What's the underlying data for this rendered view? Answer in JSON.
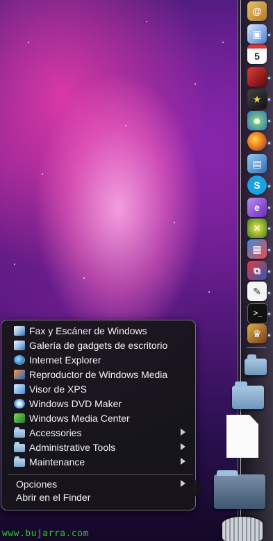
{
  "stack_menu": {
    "items": [
      {
        "label": "Fax y Escáner de Windows",
        "icon": "fax-scan-icon"
      },
      {
        "label": "Galería de gadgets de escritorio",
        "icon": "gadgets-icon"
      },
      {
        "label": "Internet Explorer",
        "icon": "internet-explorer-icon"
      },
      {
        "label": "Reproductor de Windows Media",
        "icon": "media-player-icon"
      },
      {
        "label": "Visor de XPS",
        "icon": "xps-viewer-icon"
      },
      {
        "label": "Windows DVD Maker",
        "icon": "dvd-maker-icon"
      },
      {
        "label": "Windows Media Center",
        "icon": "media-center-icon"
      },
      {
        "label": "Accessories",
        "icon": "folder-icon"
      },
      {
        "label": "Administrative Tools",
        "icon": "folder-icon"
      },
      {
        "label": "Maintenance",
        "icon": "folder-icon"
      }
    ],
    "options_label": "Opciones",
    "finder_label": "Abrir en el Finder"
  },
  "dock": {
    "icons": [
      "address-book-icon",
      "photo-app-icon",
      "calendar-icon",
      "photo-booth-icon",
      "imovie-icon",
      "messenger-icon",
      "firefox-icon",
      "remote-desktop-icon",
      "skype-icon",
      "ie-icon",
      "xcode-icon",
      "vmware-icon",
      "parallels-icon",
      "text-edit-icon",
      "terminal-icon",
      "game-icon"
    ],
    "calendar_day": "5"
  },
  "watermark": "www.bujarra.com"
}
